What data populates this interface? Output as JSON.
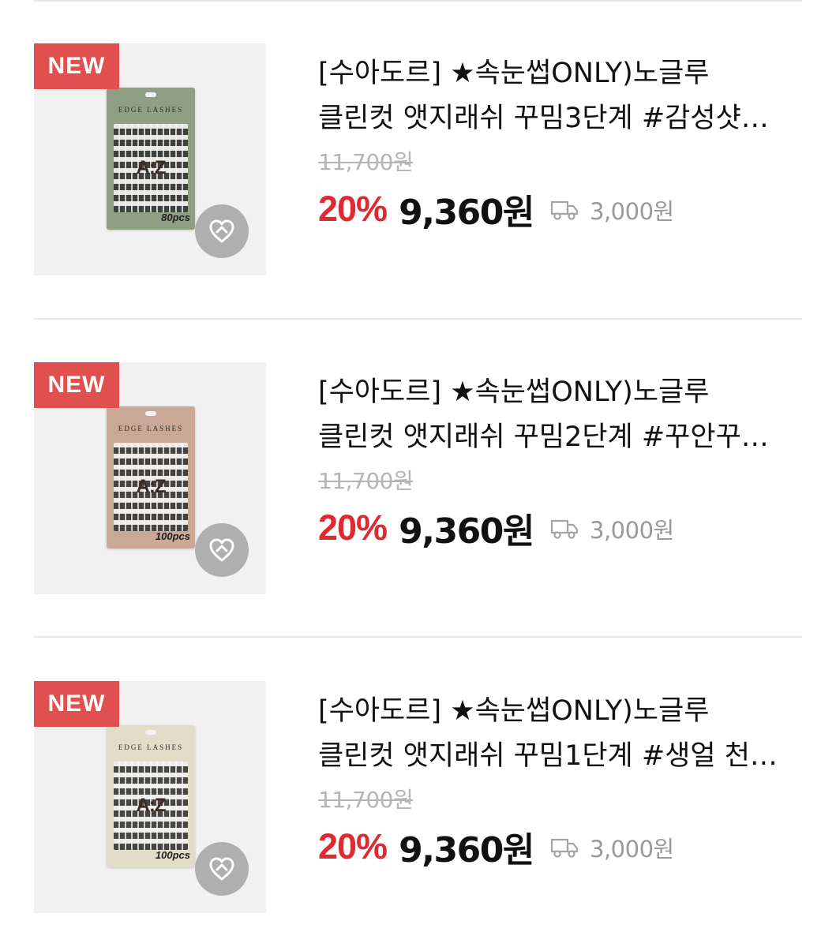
{
  "badge_label": "NEW",
  "colors": {
    "badge": "#e0504f",
    "discount": "#e02a32",
    "original_price": "#b5b5b5",
    "shipping": "#9a9a9a",
    "divider": "#e6e6e6"
  },
  "products": [
    {
      "title_line1": "[수아도르] ★속눈썹ONLY)노글루",
      "title_line2": "클린컷 앳지래쉬 꾸밈3단계 #감성샷…",
      "original_price": "11,700원",
      "discount": "20%",
      "sale_price": "9,360원",
      "shipping_fee": "3,000원",
      "package_brand": "EDGE LASHES",
      "package_logo": "A:Z",
      "package_count": "80pcs",
      "package_color": "#8f9f84",
      "icons": [
        "heart-icon",
        "delivery-truck-icon"
      ]
    },
    {
      "title_line1": "[수아도르] ★속눈썹ONLY)노글루",
      "title_line2": "클린컷 앳지래쉬 꾸밈2단계 #꾸안꾸…",
      "original_price": "11,700원",
      "discount": "20%",
      "sale_price": "9,360원",
      "shipping_fee": "3,000원",
      "package_brand": "EDGE LASHES",
      "package_logo": "A:Z",
      "package_count": "100pcs",
      "package_color": "#c9a896",
      "icons": [
        "heart-icon",
        "delivery-truck-icon"
      ]
    },
    {
      "title_line1": "[수아도르] ★속눈썹ONLY)노글루",
      "title_line2": "클린컷 앳지래쉬 꾸밈1단계 #생얼 천…",
      "original_price": "11,700원",
      "discount": "20%",
      "sale_price": "9,360원",
      "shipping_fee": "3,000원",
      "package_brand": "EDGE LASHES",
      "package_logo": "A:Z",
      "package_count": "100pcs",
      "package_color": "#e2ddc8",
      "icons": [
        "heart-icon",
        "delivery-truck-icon"
      ]
    }
  ]
}
